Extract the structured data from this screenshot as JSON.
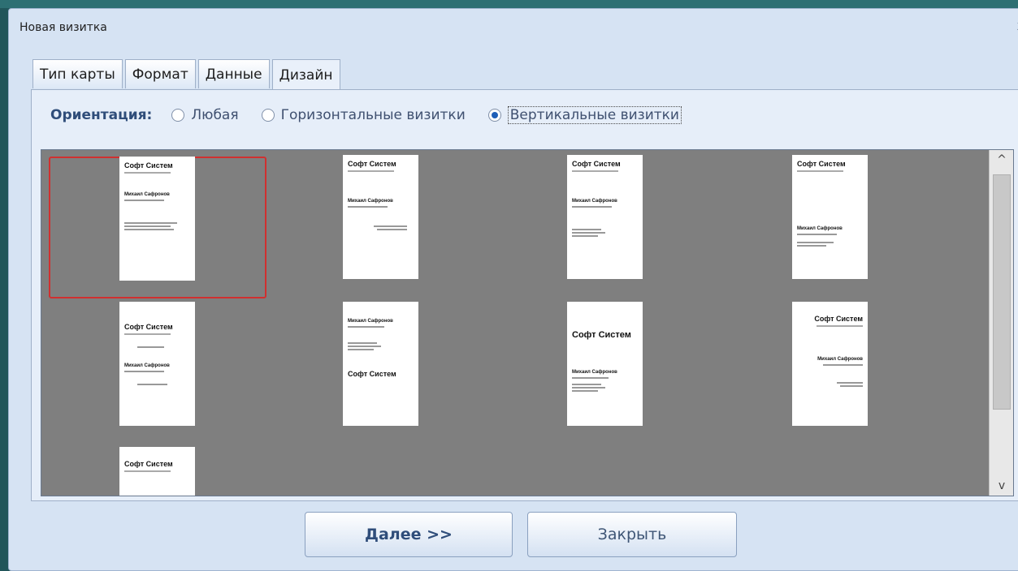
{
  "window": {
    "title": "Новая визитка",
    "close_glyph": "x"
  },
  "tabs": [
    {
      "label": "Тип карты"
    },
    {
      "label": "Формат"
    },
    {
      "label": "Данные"
    },
    {
      "label": "Дизайн"
    }
  ],
  "orientation": {
    "label": "Ориентация:",
    "options": [
      {
        "label": "Любая",
        "selected": false
      },
      {
        "label": "Горизонтальные визитки",
        "selected": false
      },
      {
        "label": "Вертикальные визитки",
        "selected": true
      }
    ]
  },
  "gallery": {
    "cards": [
      {
        "company": "Софт Систем",
        "name": "Михаил Сафронов",
        "selected": true
      },
      {
        "company": "Софт Систем",
        "name": "Михаил Сафронов"
      },
      {
        "company": "Софт Систем",
        "name": "Михаил Сафронов"
      },
      {
        "company": "Софт Систем",
        "name": "Михаил Сафронов"
      },
      {
        "company": "Софт Систем",
        "name": "Михаил Сафронов"
      },
      {
        "company": "Софт Систем",
        "name": "Михаил Сафронов"
      },
      {
        "company": "Софт Систем",
        "name": "Михаил Сафронов"
      },
      {
        "company": "Софт Систем",
        "name": "Михаил Сафронов"
      },
      {
        "company": "Софт Систем",
        "name": ""
      }
    ]
  },
  "buttons": {
    "next": "Далее >>",
    "close": "Закрыть"
  },
  "icons": {
    "scroll_up": "^",
    "scroll_down": "v"
  }
}
